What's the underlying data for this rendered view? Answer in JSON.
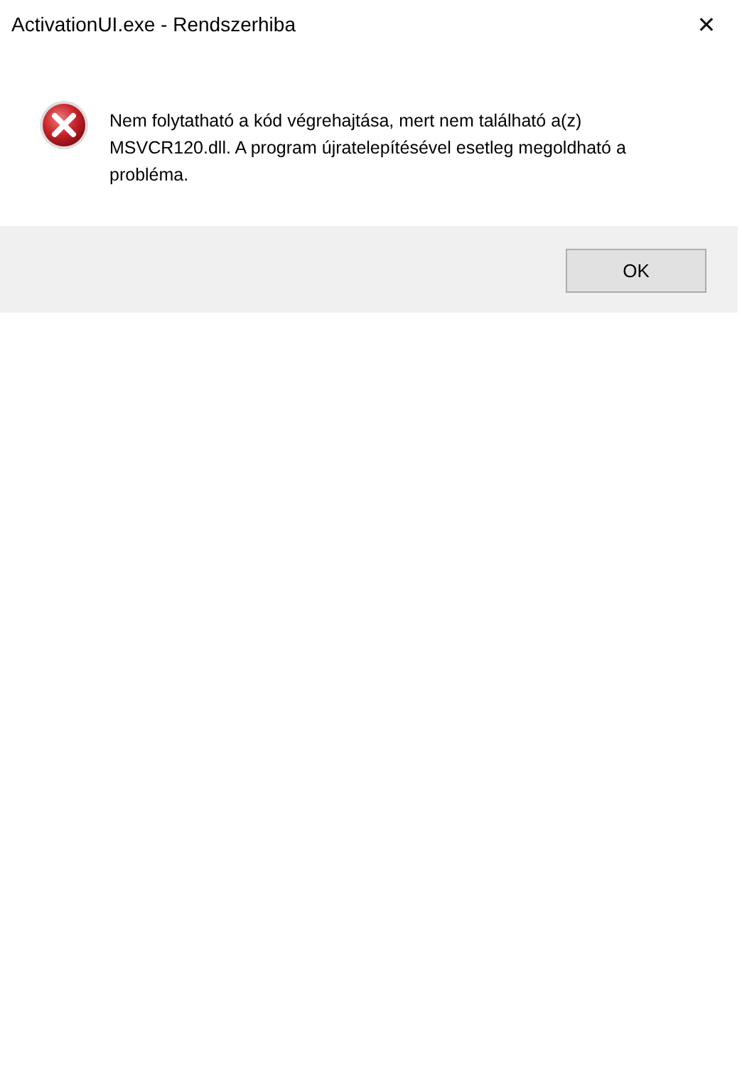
{
  "window": {
    "title": "ActivationUI.exe - Rendszerhiba",
    "close": "✕"
  },
  "message": "Nem folytatható a kód végrehajtása, mert nem található a(z) MSVCR120.dll. A program újratelepítésével esetleg megoldható a probléma.",
  "buttons": [
    "OK"
  ]
}
